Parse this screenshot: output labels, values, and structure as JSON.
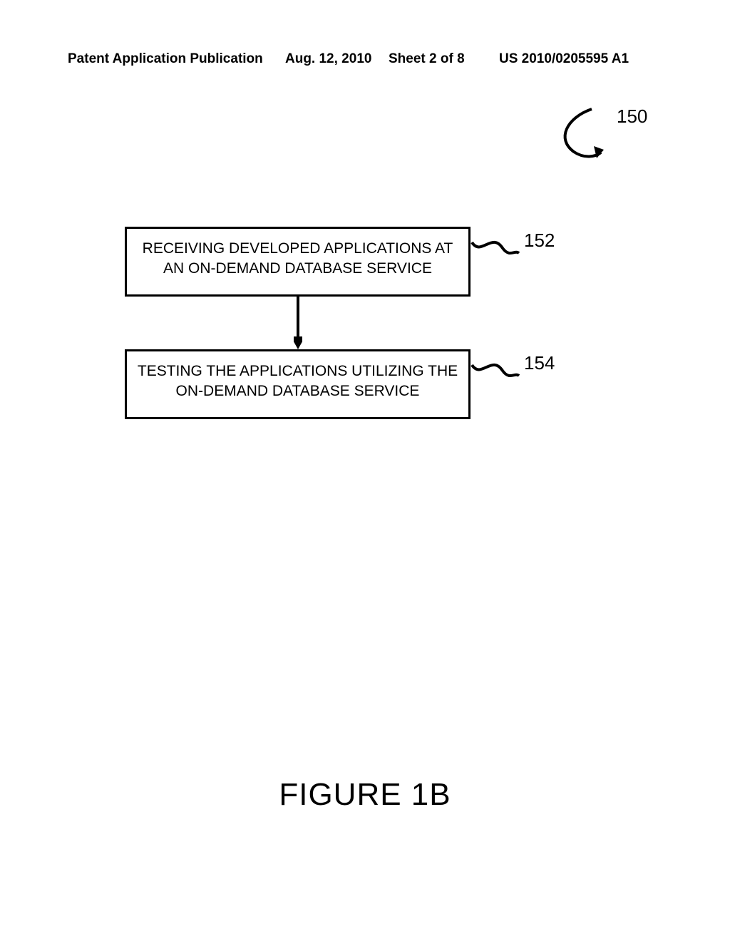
{
  "header": {
    "publication": "Patent Application Publication",
    "date": "Aug. 12, 2010",
    "sheet": "Sheet 2 of 8",
    "pubno": "US 2010/0205595 A1"
  },
  "refs": {
    "r150": "150",
    "r152": "152",
    "r154": "154"
  },
  "boxes": {
    "b152": "RECEIVING DEVELOPED APPLICATIONS AT AN ON-DEMAND DATABASE SERVICE",
    "b154": "TESTING THE APPLICATIONS UTILIZING THE ON-DEMAND DATABASE SERVICE"
  },
  "figure_label": "FIGURE 1B"
}
